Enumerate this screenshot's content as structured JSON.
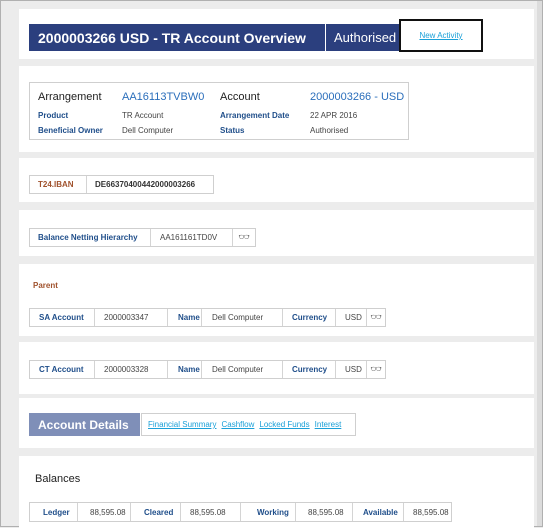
{
  "header": {
    "title": "2000003266 USD - TR Account Overview",
    "status": "Authorised",
    "new_activity": "New Activity"
  },
  "summary": {
    "arrangement_label": "Arrangement",
    "arrangement_value": "AA16113TVBW0",
    "account_label": "Account",
    "account_value": "2000003266 - USD",
    "product_label": "Product",
    "product_value": "TR Account",
    "arrangement_date_label": "Arrangement Date",
    "arrangement_date_value": "22 APR 2016",
    "beneficial_owner_label": "Beneficial Owner",
    "beneficial_owner_value": "Dell Computer",
    "status_label": "Status",
    "status_value": "Authorised"
  },
  "iban": {
    "label": "T24.IBAN",
    "value": "DE66370400442000003266"
  },
  "netting": {
    "label": "Balance Netting Hierarchy",
    "value": "AA161161TD0V",
    "icon": "glasses-icon"
  },
  "parent": {
    "heading": "Parent",
    "sa_label": "SA Account",
    "sa_value": "2000003347",
    "name_label": "Name",
    "name_value": "Dell Computer",
    "currency_label": "Currency",
    "currency_value": "USD",
    "icon": "glasses-icon"
  },
  "ct": {
    "ct_label": "CT Account",
    "ct_value": "2000003328",
    "name_label": "Name",
    "name_value": "Dell Computer",
    "currency_label": "Currency",
    "currency_value": "USD",
    "icon": "glasses-icon"
  },
  "details": {
    "title": "Account Details",
    "links": [
      "Financial Summary",
      "Cashflow",
      "Locked Funds",
      "Interest"
    ]
  },
  "balances": {
    "heading": "Balances",
    "ledger_label": "Ledger",
    "ledger_value": "88,595.08",
    "cleared_label": "Cleared",
    "cleared_value": "88,595.08",
    "working_label": "Working",
    "working_value": "88,595.08",
    "available_label": "Available",
    "available_value": "88,595.08"
  },
  "colors": {
    "header_bg": "#2b3f7e",
    "label_blue": "#1f4e8a",
    "link": "#1aa0d8",
    "iban_label": "#a0522d",
    "parent_heading": "#a0522d",
    "details_bg": "#7f8fb8"
  }
}
